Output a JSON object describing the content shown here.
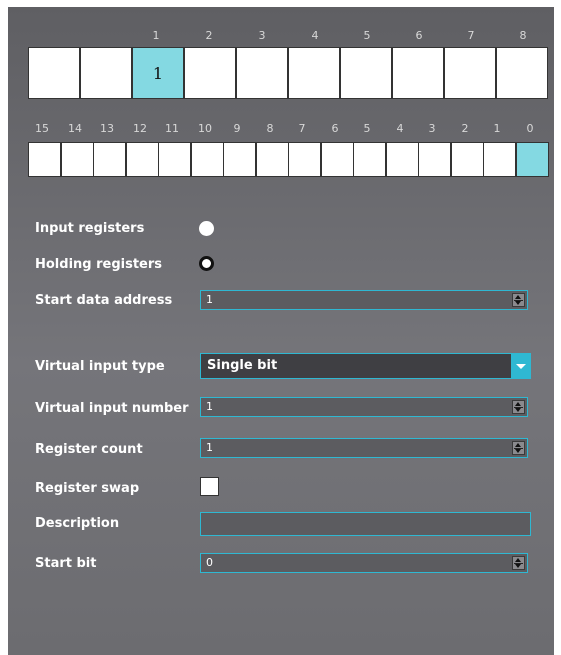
{
  "registers": {
    "numbers": [
      "",
      "1",
      "2",
      "3",
      "4",
      "5",
      "6",
      "7",
      "8"
    ],
    "cells": [
      "",
      "1",
      "",
      "",
      "",
      "",
      "",
      "",
      "",
      ""
    ],
    "active_index": 2
  },
  "bits": {
    "numbers": [
      "15",
      "14",
      "13",
      "12",
      "11",
      "10",
      "9",
      "8",
      "7",
      "6",
      "5",
      "4",
      "3",
      "2",
      "1",
      "0"
    ],
    "active_index": 15
  },
  "form": {
    "input_registers_label": "Input registers",
    "holding_registers_label": "Holding registers",
    "selected_register_type": "holding",
    "start_data_address_label": "Start data address",
    "start_data_address_value": "1",
    "virtual_input_type_label": "Virtual input type",
    "virtual_input_type_value": "Single bit",
    "virtual_input_number_label": "Virtual input number",
    "virtual_input_number_value": "1",
    "register_count_label": "Register count",
    "register_count_value": "1",
    "register_swap_label": "Register swap",
    "register_swap_checked": false,
    "description_label": "Description",
    "description_value": "",
    "start_bit_label": "Start bit",
    "start_bit_value": "0"
  },
  "colors": {
    "accent": "#2fb8d2",
    "active_cell": "#84d9e2",
    "panel": "#6b6b70"
  }
}
